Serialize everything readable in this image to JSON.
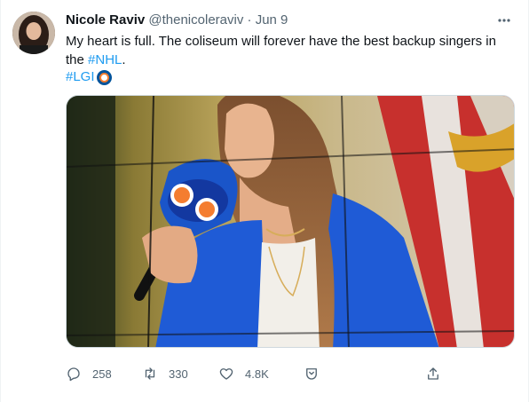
{
  "tweet": {
    "author_name": "Nicole Raviv",
    "handle": "@thenicoleraviv",
    "separator": "·",
    "date": "Jun 9",
    "text_main": "My heart is full. The coliseum will forever have the best backup singers in the ",
    "text_link": "#NHL",
    "text_end": ".",
    "hashtag": "#LGI"
  },
  "actions": {
    "replies": "258",
    "retweets": "330",
    "likes": "4.8K"
  },
  "icons": {
    "more": "more-icon",
    "reply": "reply-icon",
    "retweet": "retweet-icon",
    "like": "heart-icon",
    "save": "save-icon",
    "share": "share-icon"
  },
  "colors": {
    "link": "#1d9bf0",
    "muted": "#536471",
    "text": "#0f1419",
    "jacket": "#1f5bd6"
  }
}
